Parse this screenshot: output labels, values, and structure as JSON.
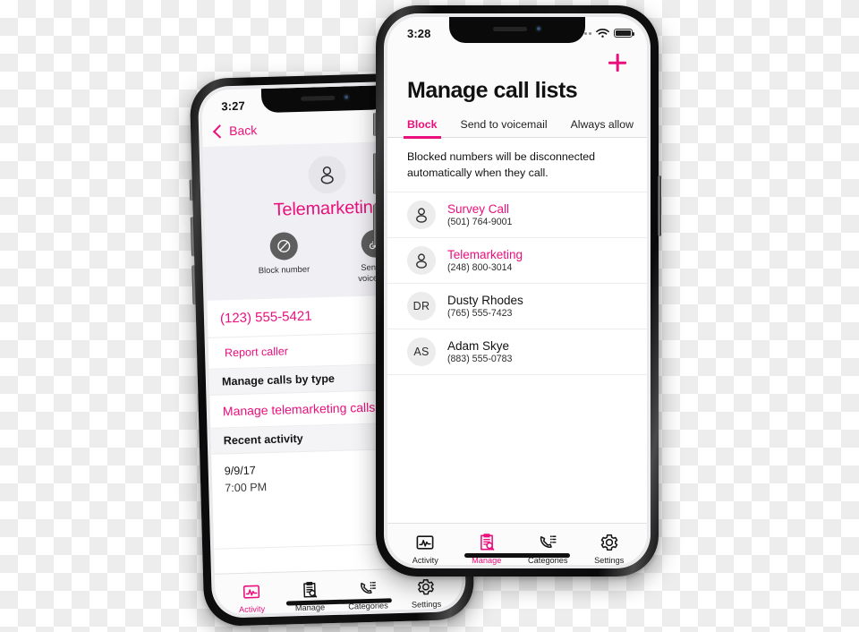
{
  "accent_color": "#ea0f7c",
  "front_phone": {
    "status_bar": {
      "time": "3:28",
      "signal_icon": "signal-dots-icon",
      "wifi_icon": "wifi-icon",
      "battery_icon": "battery-icon"
    },
    "add_button_icon": "plus-icon",
    "title": "Manage call lists",
    "tabs": [
      {
        "label": "Block",
        "active": true
      },
      {
        "label": "Send to voicemail",
        "active": false
      },
      {
        "label": "Always allow",
        "active": false
      }
    ],
    "helper_text": "Blocked numbers will be disconnected automatically when they call.",
    "entries": [
      {
        "avatar_type": "person-icon",
        "initials": "",
        "name": "Survey Call",
        "number": "(501) 764-9001",
        "flagged": true
      },
      {
        "avatar_type": "person-icon",
        "initials": "",
        "name": "Telemarketing",
        "number": "(248) 800-3014",
        "flagged": true
      },
      {
        "avatar_type": "initials",
        "initials": "DR",
        "name": "Dusty Rhodes",
        "number": "(765) 555-7423",
        "flagged": false
      },
      {
        "avatar_type": "initials",
        "initials": "AS",
        "name": "Adam Skye",
        "number": "(883) 555-0783",
        "flagged": false
      }
    ],
    "tabbar": [
      {
        "label": "Activity",
        "icon": "activity-chart-icon",
        "active": false
      },
      {
        "label": "Manage",
        "icon": "clipboard-search-icon",
        "active": true
      },
      {
        "label": "Categories",
        "icon": "phone-list-icon",
        "active": false
      },
      {
        "label": "Settings",
        "icon": "gear-icon",
        "active": false
      }
    ]
  },
  "back_phone": {
    "status_bar": {
      "time": "3:27"
    },
    "back_label": "Back",
    "contact": {
      "avatar_icon": "person-icon",
      "name": "Telemarketing",
      "actions": [
        {
          "label": "Block number",
          "icon": "block-circle-icon"
        },
        {
          "label": "Send to voicemail",
          "icon": "voicemail-forward-icon"
        }
      ]
    },
    "phone_number": "(123) 555-5421",
    "report_link": "Report caller",
    "manage_section_header": "Manage calls by type",
    "manage_link": "Manage telemarketing calls",
    "recent_section_header": "Recent activity",
    "recent_date": "9/9/17",
    "recent_time": "7:00 PM",
    "tabbar": [
      {
        "label": "Activity",
        "icon": "activity-chart-icon",
        "active": true
      },
      {
        "label": "Manage",
        "icon": "clipboard-search-icon",
        "active": false
      },
      {
        "label": "Categories",
        "icon": "phone-list-icon",
        "active": false
      },
      {
        "label": "Settings",
        "icon": "gear-icon",
        "active": false
      }
    ]
  }
}
